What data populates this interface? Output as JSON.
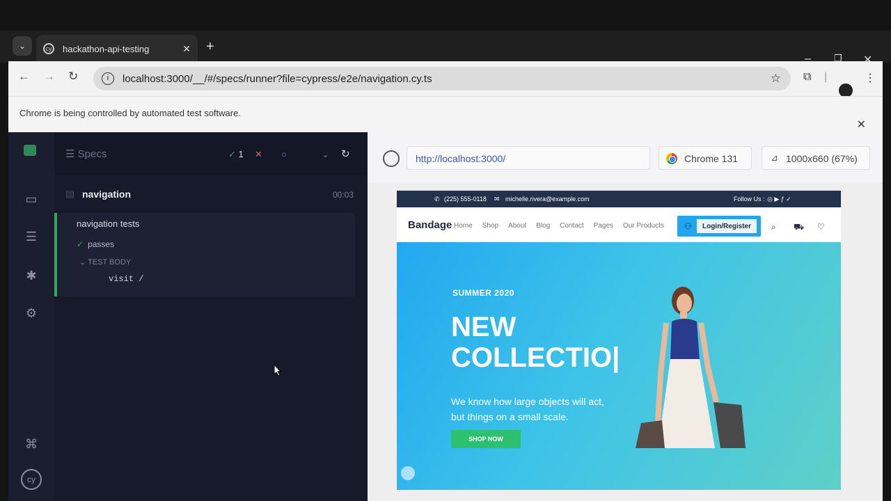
{
  "browser": {
    "tab_title": "hackathon-api-testing",
    "url": "localhost:3000/__/#/specs/runner?file=cypress/e2e/navigation.cy.ts",
    "infobar_text": "Chrome is being controlled by automated test software."
  },
  "reporter": {
    "specs_label": "Specs",
    "passed_count": "1",
    "failed_symbol": "✕",
    "pending_symbol": "○",
    "spec_name": "navigation",
    "spec_time": "00:03",
    "suite_title": "navigation tests",
    "test_title": "passes",
    "body_label": "TEST BODY",
    "command": "visit  /"
  },
  "aut": {
    "url": "http://localhost:3000/",
    "browser_label": "Chrome 131",
    "viewport_label": "1000x660 (67%)"
  },
  "site": {
    "phone": "(225) 555-0118",
    "email": "michelle.rivera@example.com",
    "follow_label": "Follow Us :",
    "brand": "Bandage",
    "nav": [
      "Home",
      "Shop",
      "About",
      "Blog",
      "Contact",
      "Pages",
      "Our Products"
    ],
    "login_label": "Login/Register",
    "hero_subtitle": "SUMMER 2020",
    "hero_title_line1": "NEW",
    "hero_title_line2": "COLLECTIO|",
    "hero_desc": "We know how large objects will act, but things on a small scale.",
    "hero_button": "SHOP NOW"
  },
  "colors": {
    "cypress_pass": "#3aa655",
    "site_primary": "#23a6f0",
    "site_dark": "#252b42",
    "hero_button": "#2dc071"
  },
  "icons": [
    "chevron-down-icon",
    "cypress-favicon-icon",
    "close-icon",
    "plus-icon",
    "back-icon",
    "forward-icon",
    "reload-icon",
    "info-icon",
    "star-icon",
    "extensions-icon",
    "profile-icon",
    "kebab-menu-icon",
    "cypress-logo-icon",
    "specs-icon",
    "runs-icon",
    "debug-icon",
    "settings-icon",
    "keyboard-shortcuts-icon",
    "target-icon",
    "viewport-icon",
    "phone-icon",
    "mail-icon",
    "search-icon",
    "cart-icon",
    "heart-icon",
    "user-icon"
  ]
}
